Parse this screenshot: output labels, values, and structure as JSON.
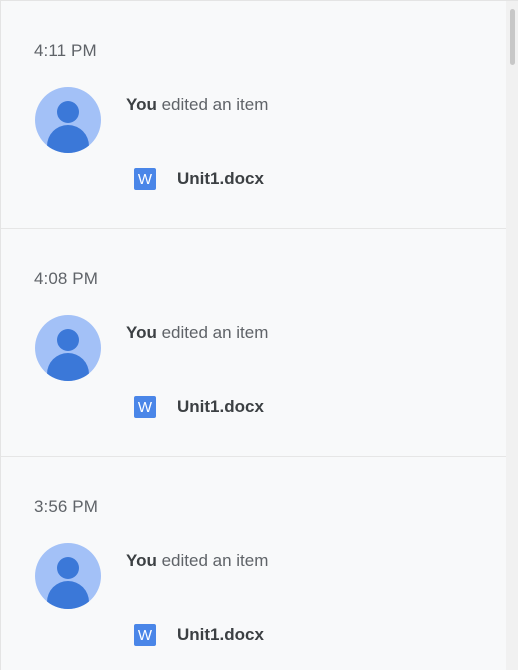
{
  "activity": {
    "entries": [
      {
        "time": "4:11 PM",
        "actor": "You",
        "action": " edited an item",
        "file": {
          "icon": "word-doc-icon",
          "icon_letter": "W",
          "name": "Unit1.docx"
        }
      },
      {
        "time": "4:08 PM",
        "actor": "You",
        "action": " edited an item",
        "file": {
          "icon": "word-doc-icon",
          "icon_letter": "W",
          "name": "Unit1.docx"
        }
      },
      {
        "time": "3:56 PM",
        "actor": "You",
        "action": " edited an item",
        "file": {
          "icon": "word-doc-icon",
          "icon_letter": "W",
          "name": "Unit1.docx"
        }
      }
    ]
  },
  "colors": {
    "avatar_bg": "#a3c1f7",
    "avatar_fg": "#3b78d8",
    "word_icon": "#4a86e8"
  }
}
